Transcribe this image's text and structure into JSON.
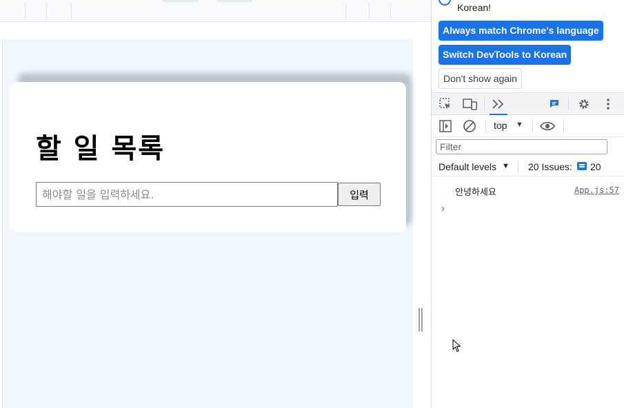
{
  "app": {
    "page_title": "할 일 목록",
    "todo_input": {
      "placeholder": "해야할 일을 입력하세요.",
      "value": ""
    },
    "submit_label": "입력"
  },
  "devtools": {
    "banner": {
      "text": "Korean!",
      "buttons": {
        "always_match": "Always match Chrome's language",
        "switch": "Switch DevTools to Korean",
        "dont_show": "Don't show again"
      }
    },
    "toolbar": {
      "icons": [
        "inspect-element-icon",
        "device-toolbar-icon",
        "more-tabs-icon",
        "messages-icon",
        "gear-icon",
        "kebab-menu-icon"
      ]
    },
    "console_toolbar": {
      "context": "top",
      "icons": [
        "sidebar-toggle-icon",
        "clear-console-icon",
        "eye-icon"
      ]
    },
    "filter": {
      "placeholder": "Filter",
      "value": ""
    },
    "levels": {
      "label": "Default levels"
    },
    "issues": {
      "label": "20 Issues:",
      "count": "20"
    },
    "log": [
      {
        "message": "안녕하세요",
        "source": "App.js:57"
      }
    ],
    "colors": {
      "accent": "#1a73e8",
      "page_bg": "#f0f7ff",
      "toolbar_bg": "#f1f3f4"
    }
  }
}
